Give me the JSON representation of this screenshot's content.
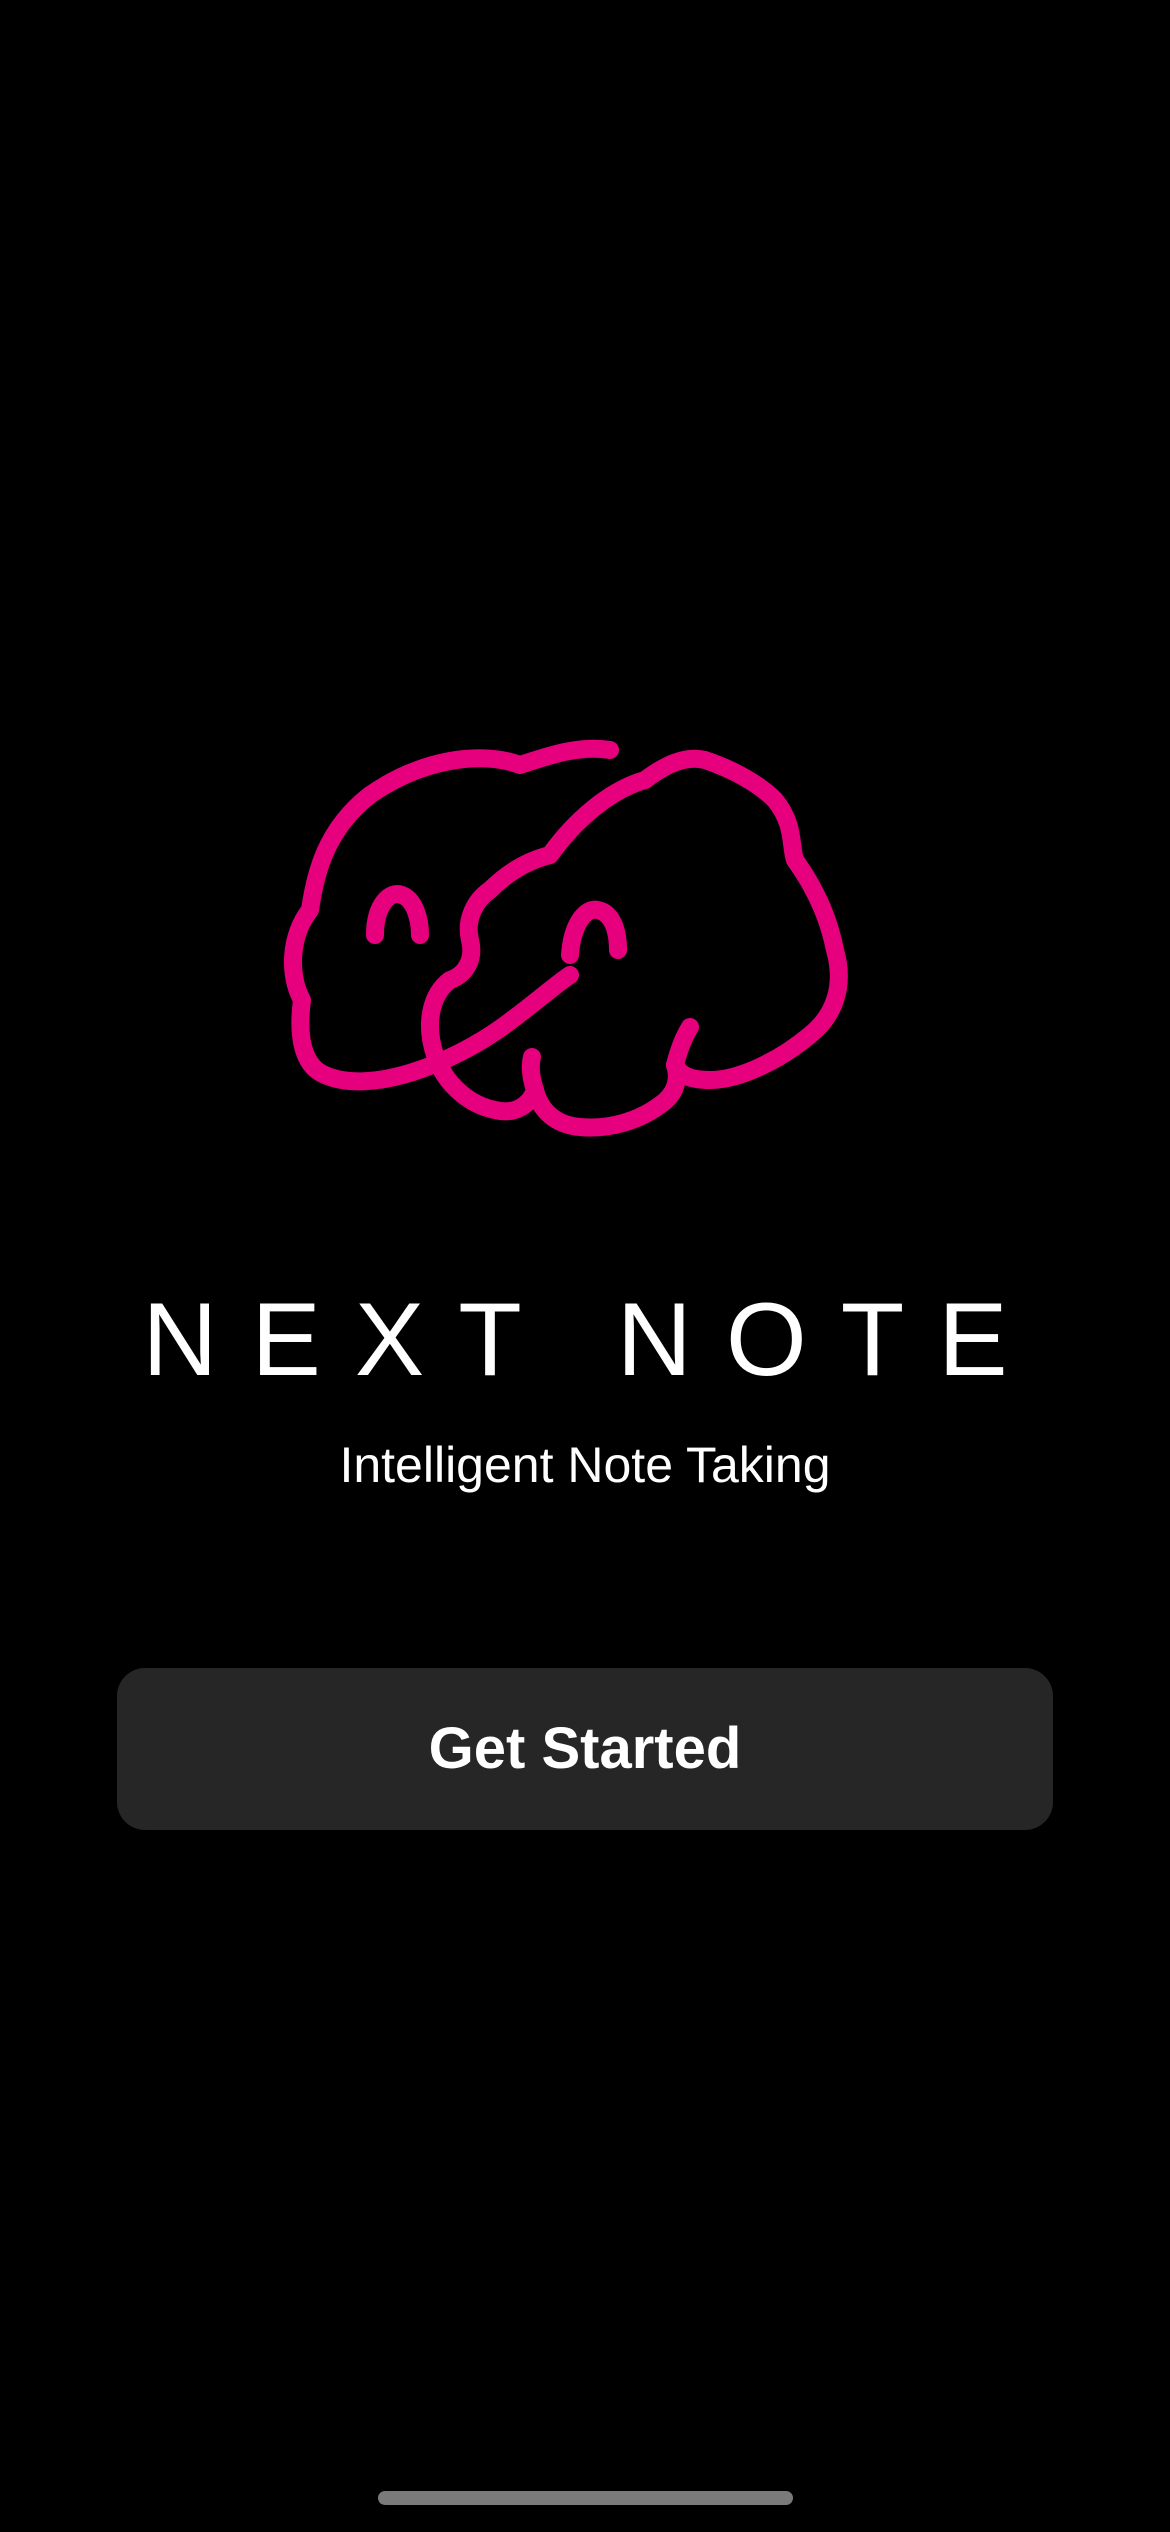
{
  "app": {
    "title": "NEXT NOTE",
    "subtitle": "Intelligent Note Taking",
    "logo_icon": "elephants-logo-icon",
    "accent_color": "#E6007E"
  },
  "actions": {
    "get_started_label": "Get Started"
  },
  "system": {
    "home_indicator": "home-indicator"
  }
}
